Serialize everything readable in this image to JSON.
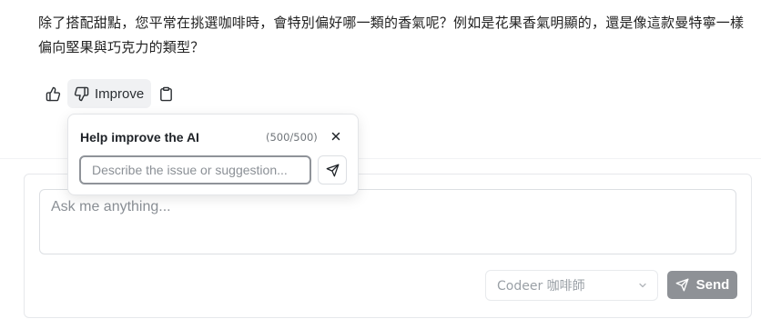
{
  "message": {
    "text": "除了搭配甜點，您平常在挑選咖啡時，會特別偏好哪一類的香氣呢？例如是花果香氣明顯的，還是像這款曼特寧一樣偏向堅果與巧克力的類型？"
  },
  "actions": {
    "like_icon": "thumbs-up-icon",
    "improve_label": "Improve",
    "improve_icon": "thumbs-down-icon",
    "copy_icon": "clipboard-icon"
  },
  "feedback": {
    "title": "Help improve the AI",
    "count": "(500/500)",
    "placeholder": "Describe the issue or suggestion...",
    "close_icon": "close-icon",
    "send_icon": "send-icon"
  },
  "composer": {
    "placeholder": "Ask me anything...",
    "model_selected": "Codeer 咖啡師",
    "send_label": "Send"
  },
  "colors": {
    "send_button": "#8e9196",
    "improve_bg": "#f0f1f3"
  }
}
